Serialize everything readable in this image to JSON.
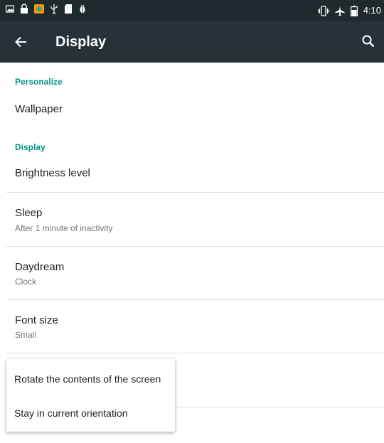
{
  "status_bar": {
    "icons": [
      "image-icon",
      "lock-icon",
      "app-icon",
      "usb-icon",
      "sd-card-icon",
      "debug-icon",
      "vibrate-icon",
      "airplane-icon",
      "battery-icon"
    ],
    "time": "4:10"
  },
  "app_bar": {
    "title": "Display",
    "back_icon": "arrow-left-icon",
    "search_icon": "search-icon"
  },
  "colors": {
    "status_bar": "#1f2a2e",
    "app_bar": "#263238",
    "accent": "#009688",
    "divider": "#e0e0e0"
  },
  "sections": [
    {
      "header": "Personalize",
      "items": [
        {
          "title": "Wallpaper"
        }
      ]
    },
    {
      "header": "Display",
      "items": [
        {
          "title": "Brightness level"
        },
        {
          "title": "Sleep",
          "subtitle": "After 1 minute of inactivity"
        },
        {
          "title": "Daydream",
          "subtitle": "Clock"
        },
        {
          "title": "Font size",
          "subtitle": "Small"
        }
      ]
    }
  ],
  "rotation_menu": {
    "options": [
      "Rotate the contents of the screen",
      "Stay in current orientation"
    ]
  }
}
